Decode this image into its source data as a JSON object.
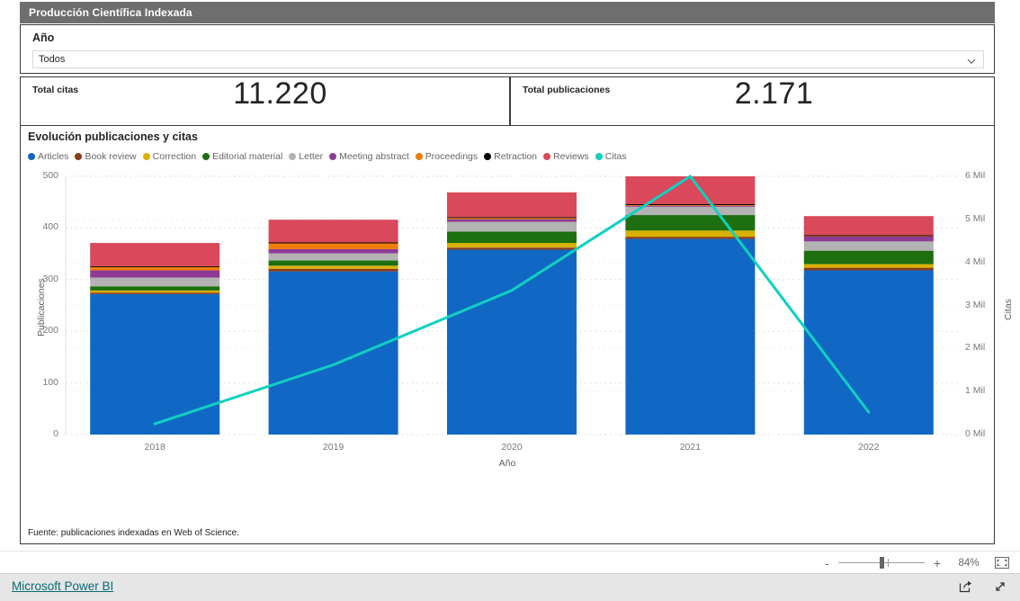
{
  "report": {
    "title": "Producción Científica Indexada"
  },
  "slicer": {
    "label": "Año",
    "value": "Todos",
    "chevron_icon": "chevron-down-icon"
  },
  "kpis": [
    {
      "label": "Total citas",
      "value": "11.220"
    },
    {
      "label": "Total publicaciones",
      "value": "2.171"
    }
  ],
  "chart_panel": {
    "title": "Evolución publicaciones y citas",
    "source": "Fuente: publicaciones indexadas en Web of Science."
  },
  "toolbar": {
    "zoom_out_label": "-",
    "zoom_in_label": "+",
    "zoom_level": "84%",
    "fit_icon": "fit-to-page-icon"
  },
  "footer": {
    "brand": "Microsoft Power BI",
    "share_icon": "share-icon",
    "fullscreen_icon": "fullscreen-icon"
  },
  "chart_data": {
    "type": "bar",
    "title": "Evolución publicaciones y citas",
    "subtitle": "",
    "xlabel": "Año",
    "ylabel": "Publicaciones",
    "y2label": "Citas",
    "categories": [
      "2018",
      "2019",
      "2020",
      "2021",
      "2022"
    ],
    "ylim": [
      0,
      500
    ],
    "yticks": [
      "0",
      "100",
      "200",
      "300",
      "400",
      "500"
    ],
    "y2lim": [
      0,
      6000
    ],
    "y2ticks": [
      "0 Mil",
      "1 Mil",
      "2 Mil",
      "3 Mil",
      "4 Mil",
      "5 Mil",
      "6 Mil"
    ],
    "grid": true,
    "legend_position": "top",
    "stacked": true,
    "series": [
      {
        "name": "Articles",
        "color": "#1168c4",
        "values": [
          272,
          316,
          358,
          379,
          318
        ]
      },
      {
        "name": "Book review",
        "color": "#8a3b17",
        "values": [
          3,
          5,
          4,
          4,
          5
        ]
      },
      {
        "name": "Correction",
        "color": "#d9b000",
        "values": [
          4,
          6,
          9,
          12,
          7
        ]
      },
      {
        "name": "Editorial material",
        "color": "#1d6f0f",
        "values": [
          8,
          10,
          22,
          30,
          26
        ]
      },
      {
        "name": "Letter",
        "color": "#b3b3b3",
        "values": [
          17,
          14,
          19,
          16,
          18
        ]
      },
      {
        "name": "Meeting abstract",
        "color": "#8f3a96",
        "values": [
          14,
          8,
          5,
          2,
          10
        ]
      },
      {
        "name": "Proceedings",
        "color": "#ef7d0c",
        "values": [
          7,
          12,
          3,
          2,
          1
        ]
      },
      {
        "name": "Retraction",
        "color": "#000000",
        "values": [
          1,
          1,
          1,
          1,
          1
        ]
      },
      {
        "name": "Reviews",
        "color": "#d9485b",
        "values": [
          45,
          44,
          48,
          54,
          37
        ]
      }
    ],
    "line_series": {
      "name": "Citas",
      "color": "#0fd1c0",
      "axis": "y2",
      "values": [
        250,
        1620,
        3350,
        6000,
        520
      ]
    }
  }
}
